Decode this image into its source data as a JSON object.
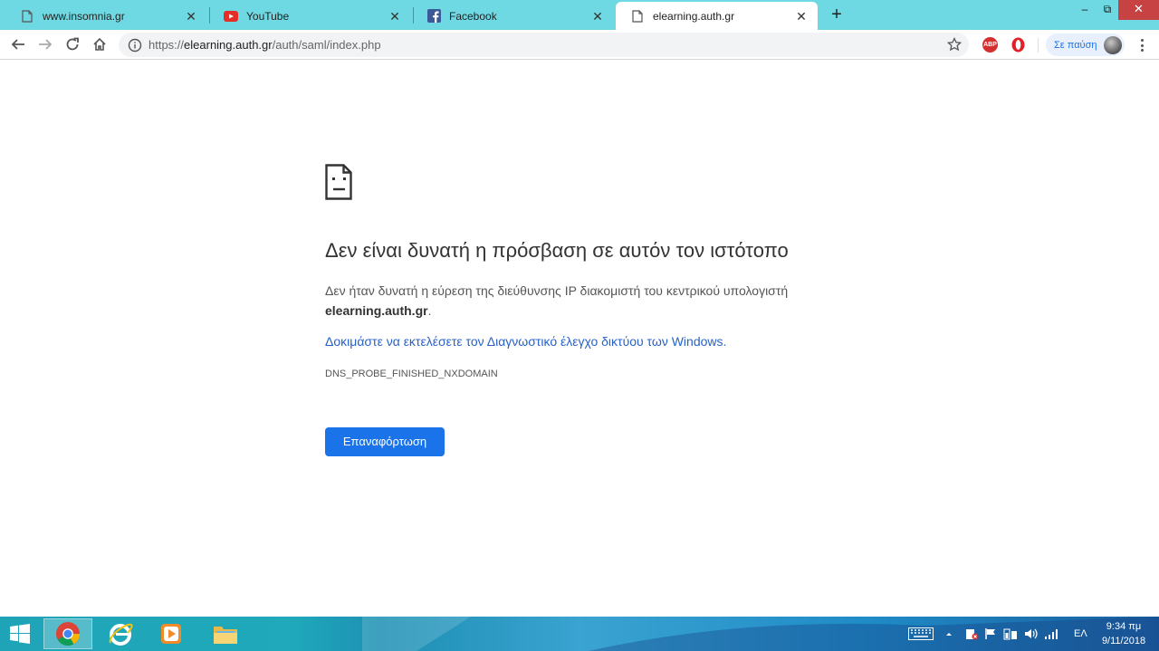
{
  "tabs": [
    {
      "title": "www.insomnia.gr",
      "icon": "page-icon",
      "active": false
    },
    {
      "title": "YouTube",
      "icon": "youtube-icon",
      "active": false
    },
    {
      "title": "Facebook",
      "icon": "facebook-icon",
      "active": false
    },
    {
      "title": "elearning.auth.gr",
      "icon": "page-icon",
      "active": true
    }
  ],
  "window": {
    "minimize": "‒",
    "maximize": "⧉",
    "close": "✕",
    "new_tab": "+",
    "tab_close": "✕"
  },
  "toolbar": {
    "url_scheme": "https://",
    "url_host": "elearning.auth.gr",
    "url_path": "/auth/saml/index.php",
    "abp_label": "ABP",
    "profile_label": "Σε παύση"
  },
  "error": {
    "title": "Δεν είναι δυνατή η πρόσβαση σε αυτόν τον ιστότοπο",
    "description": "Δεν ήταν δυνατή η εύρεση της διεύθυνσης IP διακομιστή του κεντρικού υπολογιστή",
    "host": "elearning.auth.gr",
    "host_suffix": ".",
    "diagnostics_link": "Δοκιμάστε να εκτελέσετε τον Διαγνωστικό έλεγχο δικτύου των Windows.",
    "code": "DNS_PROBE_FINISHED_NXDOMAIN",
    "reload_label": "Επαναφόρτωση"
  },
  "taskbar": {
    "apps": [
      "chrome-icon",
      "internet-explorer-icon",
      "media-player-icon",
      "file-explorer-icon"
    ],
    "language": "ΕΛ",
    "time": "9:34 πμ",
    "date": "9/11/2018"
  },
  "colors": {
    "tabstrip": "#6fd9e3",
    "link": "#2962c9",
    "button": "#1a73e8",
    "close": "#c74343"
  }
}
